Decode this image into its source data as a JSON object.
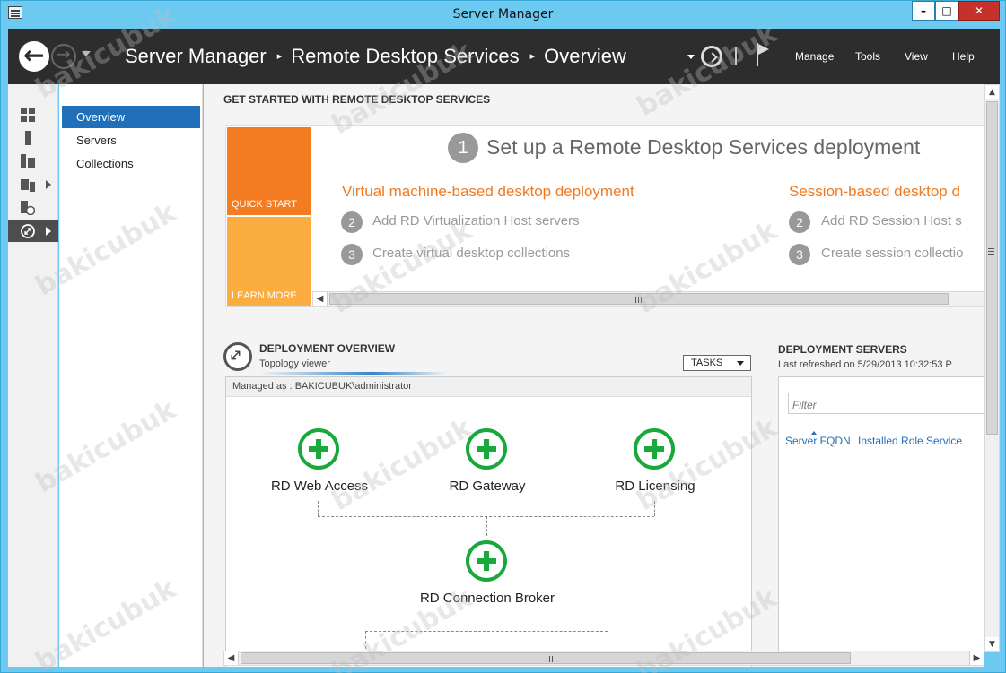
{
  "window": {
    "title": "Server Manager",
    "controls": {
      "minimize": "–",
      "maximize": "□",
      "close": "✕"
    }
  },
  "header": {
    "breadcrumb": [
      "Server Manager",
      "Remote Desktop Services",
      "Overview"
    ],
    "separator": "▸",
    "menu": [
      "Manage",
      "Tools",
      "View",
      "Help"
    ],
    "icons": [
      "back-arrow-icon",
      "forward-arrow-icon",
      "refresh-icon",
      "flag-icon"
    ]
  },
  "rail": {
    "items": [
      {
        "name": "dashboard-icon"
      },
      {
        "name": "local-server-icon"
      },
      {
        "name": "all-servers-icon"
      },
      {
        "name": "file-storage-icon"
      },
      {
        "name": "iis-icon"
      },
      {
        "name": "remote-desktop-icon"
      }
    ]
  },
  "nav": {
    "items": [
      "Overview",
      "Servers",
      "Collections"
    ],
    "active": "Overview"
  },
  "quick_start": {
    "heading": "GET STARTED WITH REMOTE DESKTOP SERVICES",
    "tile_quick_start": "QUICK START",
    "tile_learn_more": "LEARN MORE",
    "step1_num": "1",
    "step1_text": "Set up a Remote Desktop Services deployment",
    "vm_heading": "Virtual machine-based desktop deployment",
    "vm_steps": [
      {
        "num": "2",
        "text": "Add RD Virtualization Host servers"
      },
      {
        "num": "3",
        "text": "Create virtual desktop collections"
      }
    ],
    "session_heading": "Session-based desktop d",
    "session_steps": [
      {
        "num": "2",
        "text": "Add RD Session Host s"
      },
      {
        "num": "3",
        "text": "Create session collectio"
      }
    ]
  },
  "deployment_overview": {
    "heading": "DEPLOYMENT OVERVIEW",
    "subtitle": "Topology viewer",
    "tasks_label": "TASKS",
    "managed_as": "Managed as : BAKICUBUK\\administrator",
    "nodes": [
      "RD Web Access",
      "RD Gateway",
      "RD Licensing",
      "RD Connection Broker"
    ]
  },
  "deployment_servers": {
    "heading": "DEPLOYMENT SERVERS",
    "last_refreshed": "Last refreshed on 5/29/2013 10:32:53 P",
    "filter_placeholder": "Filter",
    "columns": [
      "Server FQDN",
      "Installed Role Service"
    ]
  },
  "watermark": "bakicubuk",
  "colors": {
    "accent_blue": "#1f6fba",
    "quick_start_orange": "#f37b21",
    "learn_more_orange": "#fbad3f",
    "plus_green": "#19a83b",
    "header_dark": "#2d2d2d"
  }
}
